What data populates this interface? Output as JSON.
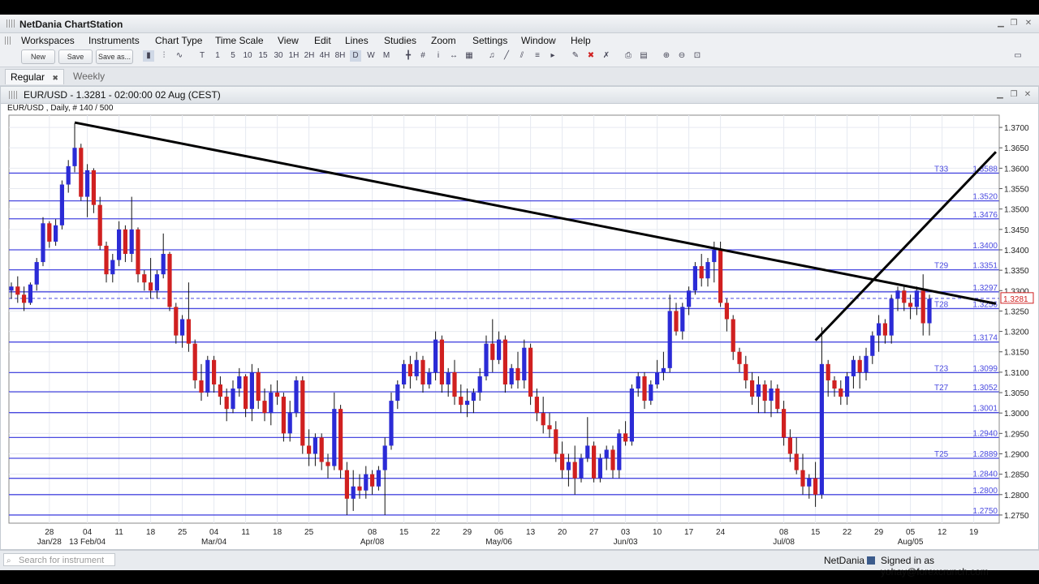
{
  "app": {
    "title": "NetDania ChartStation"
  },
  "menu": [
    "Workspaces",
    "Instruments",
    "Chart Type",
    "Time Scale",
    "View",
    "Edit",
    "Lines",
    "Studies",
    "Zoom",
    "Settings",
    "Window",
    "Help"
  ],
  "toolbar": {
    "new_label": "New",
    "save_label": "Save",
    "saveas_label": "Save as...",
    "timescales": [
      "T",
      "1",
      "5",
      "10",
      "15",
      "30",
      "1H",
      "2H",
      "4H",
      "8H",
      "D",
      "W",
      "M"
    ]
  },
  "tabs": [
    {
      "label": "Regular",
      "close": "✖"
    },
    {
      "label": "Weekly"
    }
  ],
  "chart_window": {
    "title": "EUR/USD - 1.3281 - 02:00:00  02 Aug (CEST)",
    "info": "EUR/USD , Daily, # 140 / 500"
  },
  "status": {
    "search_placeholder": "Search for instrument",
    "brand": "NetDania",
    "signed_in": "Signed in as yohay@forexcrunch.com"
  },
  "colors": {
    "up": "#2b2bd6",
    "down": "#d02020",
    "hline": "#4a4ae0",
    "trend": "#000000"
  },
  "chart_data": {
    "type": "candlestick",
    "ylim": [
      1.273,
      1.373
    ],
    "y_ticks": [
      1.275,
      1.28,
      1.285,
      1.29,
      1.295,
      1.3,
      1.305,
      1.31,
      1.315,
      1.32,
      1.325,
      1.33,
      1.335,
      1.34,
      1.345,
      1.35,
      1.355,
      1.36,
      1.365,
      1.37
    ],
    "x_ticks": [
      {
        "label": "28",
        "i": 6
      },
      {
        "label": "04",
        "i": 12
      },
      {
        "label": "11",
        "i": 17
      },
      {
        "label": "18",
        "i": 22
      },
      {
        "label": "25",
        "i": 27
      },
      {
        "label": "04",
        "i": 32
      },
      {
        "label": "11",
        "i": 37
      },
      {
        "label": "18",
        "i": 42
      },
      {
        "label": "25",
        "i": 47
      },
      {
        "label": "08",
        "i": 57
      },
      {
        "label": "15",
        "i": 62
      },
      {
        "label": "22",
        "i": 67
      },
      {
        "label": "29",
        "i": 72
      },
      {
        "label": "06",
        "i": 77
      },
      {
        "label": "13",
        "i": 82
      },
      {
        "label": "20",
        "i": 87
      },
      {
        "label": "27",
        "i": 92
      },
      {
        "label": "03",
        "i": 97
      },
      {
        "label": "10",
        "i": 102
      },
      {
        "label": "17",
        "i": 107
      },
      {
        "label": "24",
        "i": 112
      },
      {
        "label": "08",
        "i": 122
      },
      {
        "label": "15",
        "i": 127
      },
      {
        "label": "22",
        "i": 132
      },
      {
        "label": "29",
        "i": 137
      },
      {
        "label": "05",
        "i": 142
      },
      {
        "label": "12",
        "i": 147
      },
      {
        "label": "19",
        "i": 152
      }
    ],
    "month_labels": [
      {
        "label": "Jan/28",
        "i": 6
      },
      {
        "label": "13 Feb/04",
        "i": 12
      },
      {
        "label": "Mar/04",
        "i": 32
      },
      {
        "label": "Apr/08",
        "i": 57
      },
      {
        "label": "May/06",
        "i": 77
      },
      {
        "label": "Jun/03",
        "i": 97
      },
      {
        "label": "Jul/08",
        "i": 122
      },
      {
        "label": "Aug/05",
        "i": 142
      }
    ],
    "current_price": 1.3281,
    "current_label": "1.3281",
    "levels": [
      {
        "price": 1.3588,
        "label": "1.3588",
        "tag": "T33"
      },
      {
        "price": 1.352,
        "label": "1.3520",
        "tag": ""
      },
      {
        "price": 1.3476,
        "label": "1.3476",
        "tag": ""
      },
      {
        "price": 1.34,
        "label": "1.3400",
        "tag": ""
      },
      {
        "price": 1.3351,
        "label": "1.3351",
        "tag": "T29"
      },
      {
        "price": 1.3297,
        "label": "1.3297",
        "tag": ""
      },
      {
        "price": 1.3256,
        "label": "1.3256",
        "tag": "T28"
      },
      {
        "price": 1.3174,
        "label": "1.3174",
        "tag": ""
      },
      {
        "price": 1.3099,
        "label": "1.3099",
        "tag": "T23"
      },
      {
        "price": 1.3052,
        "label": "1.3052",
        "tag": "T27"
      },
      {
        "price": 1.3001,
        "label": "1.3001",
        "tag": ""
      },
      {
        "price": 1.294,
        "label": "1.2940",
        "tag": ""
      },
      {
        "price": 1.2889,
        "label": "1.2889",
        "tag": "T25"
      },
      {
        "price": 1.284,
        "label": "1.2840",
        "tag": ""
      },
      {
        "price": 1.28,
        "label": "1.2800",
        "tag": ""
      },
      {
        "price": 1.275,
        "label": "1.2750",
        "tag": ""
      }
    ],
    "trendlines": [
      {
        "i1": 10,
        "p1": 1.3712,
        "i2": 155.5,
        "p2": 1.3268
      },
      {
        "i1": 127,
        "p1": 1.3178,
        "i2": 155.5,
        "p2": 1.364
      }
    ],
    "candles": [
      [
        1.33,
        1.332,
        1.328,
        1.331
      ],
      [
        1.331,
        1.3335,
        1.327,
        1.329
      ],
      [
        1.329,
        1.331,
        1.325,
        1.327
      ],
      [
        1.327,
        1.332,
        1.3265,
        1.3315
      ],
      [
        1.3315,
        1.338,
        1.33,
        1.337
      ],
      [
        1.337,
        1.348,
        1.336,
        1.3465
      ],
      [
        1.3465,
        1.347,
        1.3405,
        1.342
      ],
      [
        1.342,
        1.3475,
        1.341,
        1.346
      ],
      [
        1.346,
        1.357,
        1.345,
        1.356
      ],
      [
        1.356,
        1.362,
        1.354,
        1.3605
      ],
      [
        1.3605,
        1.371,
        1.359,
        1.365
      ],
      [
        1.365,
        1.366,
        1.352,
        1.353
      ],
      [
        1.353,
        1.361,
        1.348,
        1.3595
      ],
      [
        1.3595,
        1.36,
        1.349,
        1.351
      ],
      [
        1.351,
        1.353,
        1.34,
        1.341
      ],
      [
        1.341,
        1.342,
        1.332,
        1.334
      ],
      [
        1.334,
        1.339,
        1.332,
        1.3375
      ],
      [
        1.3375,
        1.347,
        1.336,
        1.345
      ],
      [
        1.345,
        1.346,
        1.337,
        1.339
      ],
      [
        1.339,
        1.353,
        1.337,
        1.345
      ],
      [
        1.345,
        1.3455,
        1.332,
        1.334
      ],
      [
        1.334,
        1.335,
        1.33,
        1.332
      ],
      [
        1.332,
        1.338,
        1.328,
        1.33
      ],
      [
        1.33,
        1.335,
        1.328,
        1.334
      ],
      [
        1.334,
        1.344,
        1.333,
        1.339
      ],
      [
        1.339,
        1.3395,
        1.325,
        1.326
      ],
      [
        1.326,
        1.327,
        1.317,
        1.319
      ],
      [
        1.319,
        1.324,
        1.316,
        1.323
      ],
      [
        1.323,
        1.332,
        1.315,
        1.317
      ],
      [
        1.317,
        1.318,
        1.306,
        1.308
      ],
      [
        1.308,
        1.312,
        1.303,
        1.305
      ],
      [
        1.305,
        1.314,
        1.304,
        1.313
      ],
      [
        1.313,
        1.314,
        1.305,
        1.307
      ],
      [
        1.307,
        1.309,
        1.302,
        1.304
      ],
      [
        1.304,
        1.306,
        1.298,
        1.301
      ],
      [
        1.301,
        1.308,
        1.3,
        1.306
      ],
      [
        1.306,
        1.311,
        1.304,
        1.309
      ],
      [
        1.309,
        1.3095,
        1.299,
        1.301
      ],
      [
        1.301,
        1.312,
        1.298,
        1.31
      ],
      [
        1.31,
        1.311,
        1.301,
        1.303
      ],
      [
        1.303,
        1.306,
        1.298,
        1.3
      ],
      [
        1.3,
        1.307,
        1.297,
        1.305
      ],
      [
        1.305,
        1.308,
        1.302,
        1.304
      ],
      [
        1.304,
        1.305,
        1.293,
        1.295
      ],
      [
        1.295,
        1.303,
        1.293,
        1.3
      ],
      [
        1.3,
        1.309,
        1.299,
        1.308
      ],
      [
        1.308,
        1.309,
        1.29,
        1.292
      ],
      [
        1.292,
        1.296,
        1.287,
        1.29
      ],
      [
        1.29,
        1.295,
        1.287,
        1.294
      ],
      [
        1.294,
        1.295,
        1.286,
        1.288
      ],
      [
        1.288,
        1.29,
        1.284,
        1.287
      ],
      [
        1.287,
        1.305,
        1.286,
        1.301
      ],
      [
        1.301,
        1.302,
        1.284,
        1.286
      ],
      [
        1.286,
        1.288,
        1.275,
        1.279
      ],
      [
        1.279,
        1.286,
        1.276,
        1.282
      ],
      [
        1.282,
        1.285,
        1.279,
        1.281
      ],
      [
        1.281,
        1.287,
        1.279,
        1.285
      ],
      [
        1.285,
        1.286,
        1.28,
        1.282
      ],
      [
        1.282,
        1.287,
        1.281,
        1.286
      ],
      [
        1.286,
        1.294,
        1.275,
        1.292
      ],
      [
        1.292,
        1.305,
        1.291,
        1.303
      ],
      [
        1.303,
        1.308,
        1.301,
        1.307
      ],
      [
        1.307,
        1.313,
        1.306,
        1.312
      ],
      [
        1.312,
        1.314,
        1.306,
        1.309
      ],
      [
        1.309,
        1.315,
        1.308,
        1.313
      ],
      [
        1.313,
        1.314,
        1.305,
        1.307
      ],
      [
        1.307,
        1.311,
        1.306,
        1.31
      ],
      [
        1.31,
        1.32,
        1.308,
        1.318
      ],
      [
        1.318,
        1.319,
        1.305,
        1.307
      ],
      [
        1.307,
        1.311,
        1.304,
        1.31
      ],
      [
        1.31,
        1.313,
        1.302,
        1.304
      ],
      [
        1.304,
        1.307,
        1.3,
        1.302
      ],
      [
        1.302,
        1.306,
        1.299,
        1.303
      ],
      [
        1.303,
        1.306,
        1.3,
        1.305
      ],
      [
        1.305,
        1.311,
        1.303,
        1.309
      ],
      [
        1.309,
        1.319,
        1.308,
        1.317
      ],
      [
        1.317,
        1.323,
        1.31,
        1.313
      ],
      [
        1.313,
        1.32,
        1.312,
        1.318
      ],
      [
        1.318,
        1.319,
        1.305,
        1.307
      ],
      [
        1.307,
        1.312,
        1.306,
        1.311
      ],
      [
        1.311,
        1.315,
        1.306,
        1.308
      ],
      [
        1.308,
        1.318,
        1.306,
        1.316
      ],
      [
        1.316,
        1.317,
        1.302,
        1.304
      ],
      [
        1.304,
        1.306,
        1.298,
        1.3
      ],
      [
        1.3,
        1.304,
        1.295,
        1.297
      ],
      [
        1.297,
        1.3,
        1.294,
        1.296
      ],
      [
        1.296,
        1.298,
        1.288,
        1.29
      ],
      [
        1.29,
        1.293,
        1.284,
        1.286
      ],
      [
        1.286,
        1.29,
        1.282,
        1.288
      ],
      [
        1.288,
        1.292,
        1.28,
        1.284
      ],
      [
        1.284,
        1.29,
        1.283,
        1.289
      ],
      [
        1.289,
        1.299,
        1.288,
        1.292
      ],
      [
        1.292,
        1.293,
        1.283,
        1.284
      ],
      [
        1.284,
        1.29,
        1.283,
        1.289
      ],
      [
        1.289,
        1.292,
        1.286,
        1.291
      ],
      [
        1.291,
        1.292,
        1.284,
        1.286
      ],
      [
        1.286,
        1.296,
        1.284,
        1.295
      ],
      [
        1.295,
        1.298,
        1.292,
        1.293
      ],
      [
        1.293,
        1.307,
        1.292,
        1.306
      ],
      [
        1.306,
        1.31,
        1.304,
        1.309
      ],
      [
        1.309,
        1.31,
        1.301,
        1.303
      ],
      [
        1.303,
        1.308,
        1.302,
        1.307
      ],
      [
        1.307,
        1.313,
        1.306,
        1.31
      ],
      [
        1.31,
        1.315,
        1.308,
        1.311
      ],
      [
        1.311,
        1.329,
        1.31,
        1.325
      ],
      [
        1.325,
        1.327,
        1.319,
        1.32
      ],
      [
        1.32,
        1.327,
        1.318,
        1.326
      ],
      [
        1.326,
        1.331,
        1.324,
        1.33
      ],
      [
        1.33,
        1.337,
        1.329,
        1.336
      ],
      [
        1.336,
        1.339,
        1.331,
        1.333
      ],
      [
        1.333,
        1.338,
        1.331,
        1.337
      ],
      [
        1.337,
        1.342,
        1.332,
        1.34
      ],
      [
        1.34,
        1.342,
        1.326,
        1.327
      ],
      [
        1.327,
        1.328,
        1.32,
        1.323
      ],
      [
        1.323,
        1.324,
        1.313,
        1.315
      ],
      [
        1.315,
        1.316,
        1.31,
        1.312
      ],
      [
        1.312,
        1.314,
        1.306,
        1.308
      ],
      [
        1.308,
        1.31,
        1.302,
        1.304
      ],
      [
        1.304,
        1.309,
        1.3,
        1.307
      ],
      [
        1.307,
        1.308,
        1.3,
        1.303
      ],
      [
        1.303,
        1.308,
        1.299,
        1.306
      ],
      [
        1.306,
        1.307,
        1.3,
        1.301
      ],
      [
        1.301,
        1.303,
        1.292,
        1.294
      ],
      [
        1.294,
        1.296,
        1.288,
        1.29
      ],
      [
        1.29,
        1.294,
        1.285,
        1.286
      ],
      [
        1.286,
        1.29,
        1.28,
        1.282
      ],
      [
        1.282,
        1.285,
        1.279,
        1.284
      ],
      [
        1.284,
        1.288,
        1.277,
        1.28
      ],
      [
        1.28,
        1.321,
        1.279,
        1.312
      ],
      [
        1.312,
        1.313,
        1.304,
        1.308
      ],
      [
        1.308,
        1.309,
        1.304,
        1.306
      ],
      [
        1.306,
        1.308,
        1.302,
        1.304
      ],
      [
        1.304,
        1.31,
        1.302,
        1.309
      ],
      [
        1.309,
        1.314,
        1.306,
        1.313
      ],
      [
        1.313,
        1.314,
        1.306,
        1.31
      ],
      [
        1.31,
        1.316,
        1.308,
        1.314
      ],
      [
        1.314,
        1.32,
        1.312,
        1.319
      ],
      [
        1.319,
        1.324,
        1.315,
        1.322
      ],
      [
        1.322,
        1.323,
        1.317,
        1.319
      ],
      [
        1.319,
        1.329,
        1.317,
        1.328
      ],
      [
        1.328,
        1.331,
        1.325,
        1.33
      ],
      [
        1.33,
        1.331,
        1.325,
        1.327
      ],
      [
        1.327,
        1.329,
        1.323,
        1.326
      ],
      [
        1.326,
        1.331,
        1.324,
        1.33
      ],
      [
        1.33,
        1.334,
        1.319,
        1.322
      ],
      [
        1.322,
        1.329,
        1.319,
        1.328
      ]
    ]
  }
}
